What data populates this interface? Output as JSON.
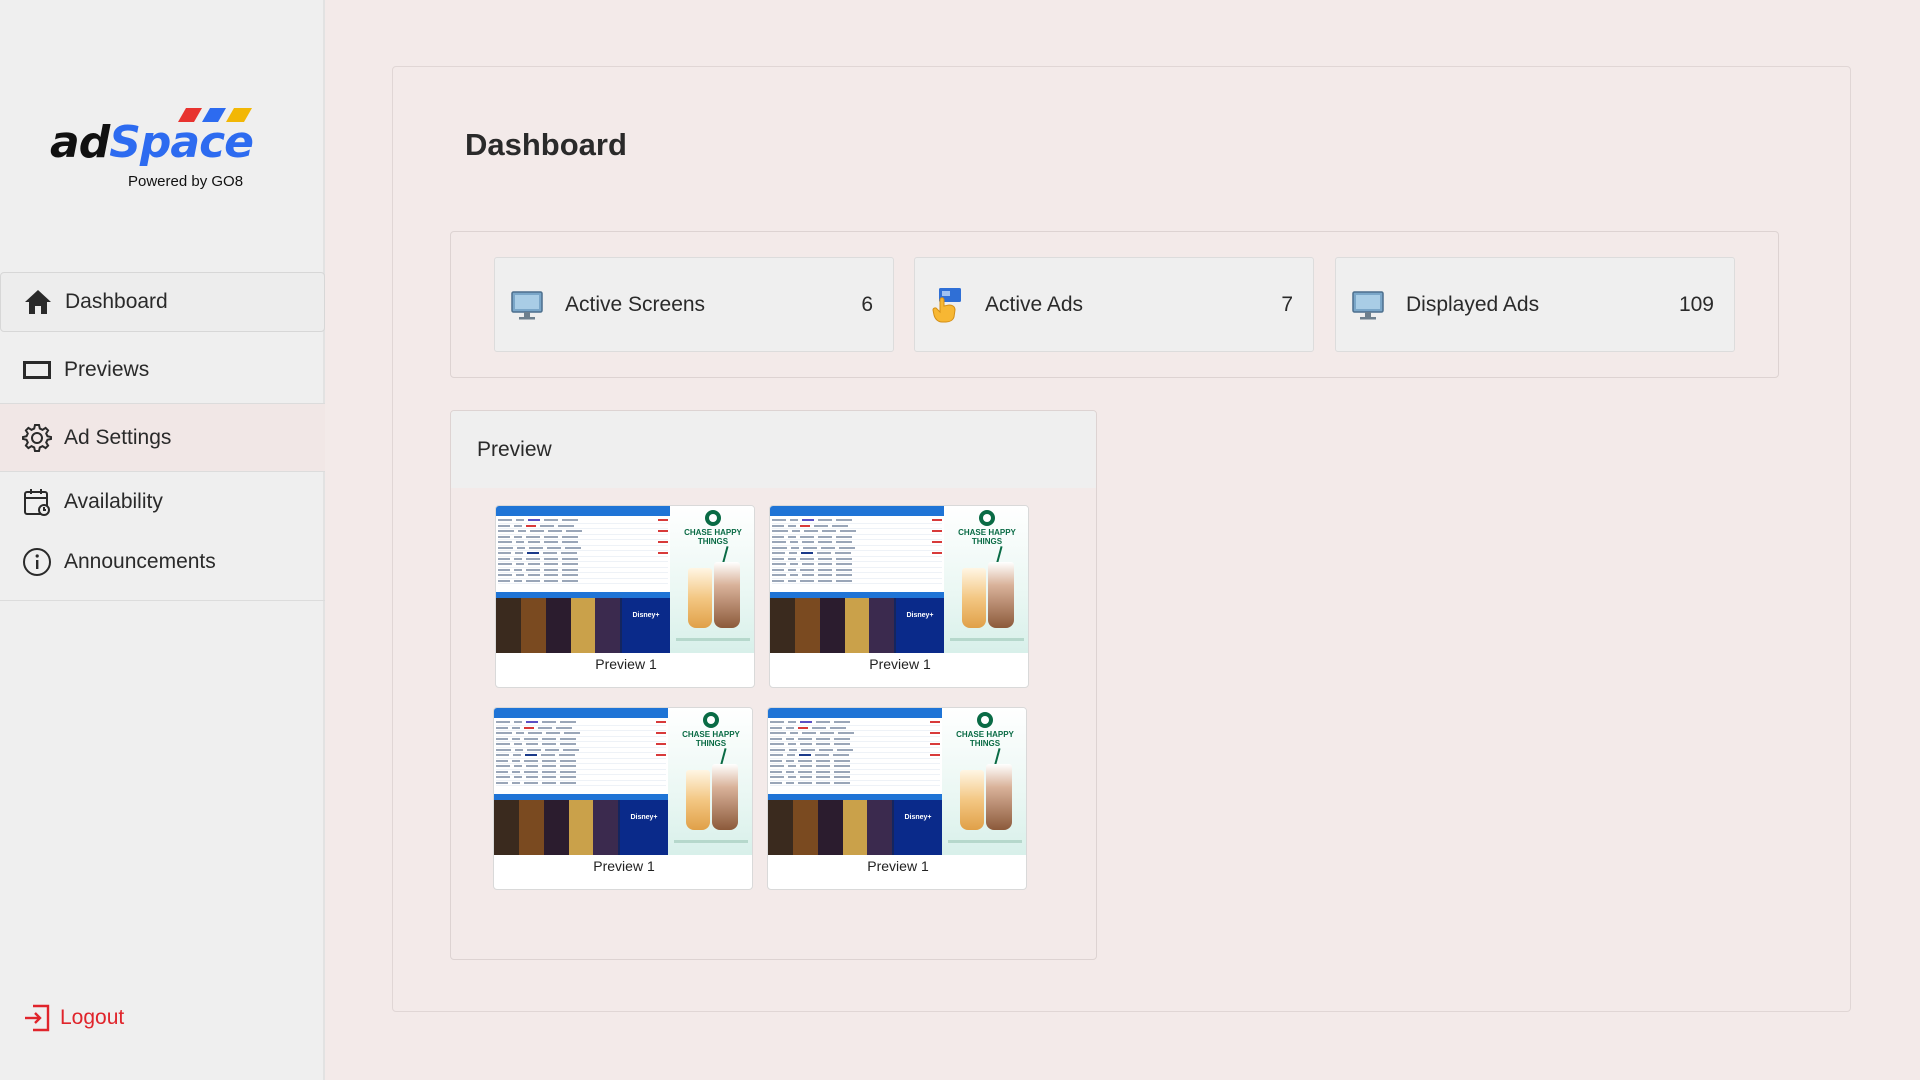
{
  "brand": {
    "name_ad": "ad",
    "name_space": "Space",
    "powered_by": "Powered by GO8",
    "stripe_colors": [
      "#e8332f",
      "#2d6bf0",
      "#f2b705"
    ]
  },
  "sidebar": {
    "items": [
      {
        "label": "Dashboard",
        "icon": "home-icon",
        "state": "active"
      },
      {
        "label": "Previews",
        "icon": "screen-icon",
        "state": "normal"
      },
      {
        "label": "Ad Settings",
        "icon": "gear-icon",
        "state": "hover"
      },
      {
        "label": "Availability",
        "icon": "calendar-icon",
        "state": "normal"
      },
      {
        "label": "Announcements",
        "icon": "info-icon",
        "state": "normal"
      }
    ],
    "logout_label": "Logout"
  },
  "main": {
    "title": "Dashboard",
    "stats": [
      {
        "label": "Active Screens",
        "value": "6",
        "icon": "monitor-icon"
      },
      {
        "label": "Active Ads",
        "value": "7",
        "icon": "tap-hand-icon"
      },
      {
        "label": "Displayed Ads",
        "value": "109",
        "icon": "monitor-icon"
      }
    ],
    "preview": {
      "heading": "Preview",
      "items": [
        {
          "caption": "Preview 1",
          "ad_text": "CHASE HAPPY THINGS",
          "promo_text": "Disney+"
        },
        {
          "caption": "Preview 1",
          "ad_text": "CHASE HAPPY THINGS",
          "promo_text": "Disney+"
        },
        {
          "caption": "Preview 1",
          "ad_text": "CHASE HAPPY THINGS",
          "promo_text": "Disney+"
        },
        {
          "caption": "Preview 1",
          "ad_text": "CHASE HAPPY THINGS",
          "promo_text": "Disney+"
        }
      ]
    }
  },
  "colors": {
    "accent_blue": "#2d6bf0",
    "logout_red": "#e0242b",
    "background": "#f3eae9",
    "sidebar_bg": "#efefef"
  }
}
